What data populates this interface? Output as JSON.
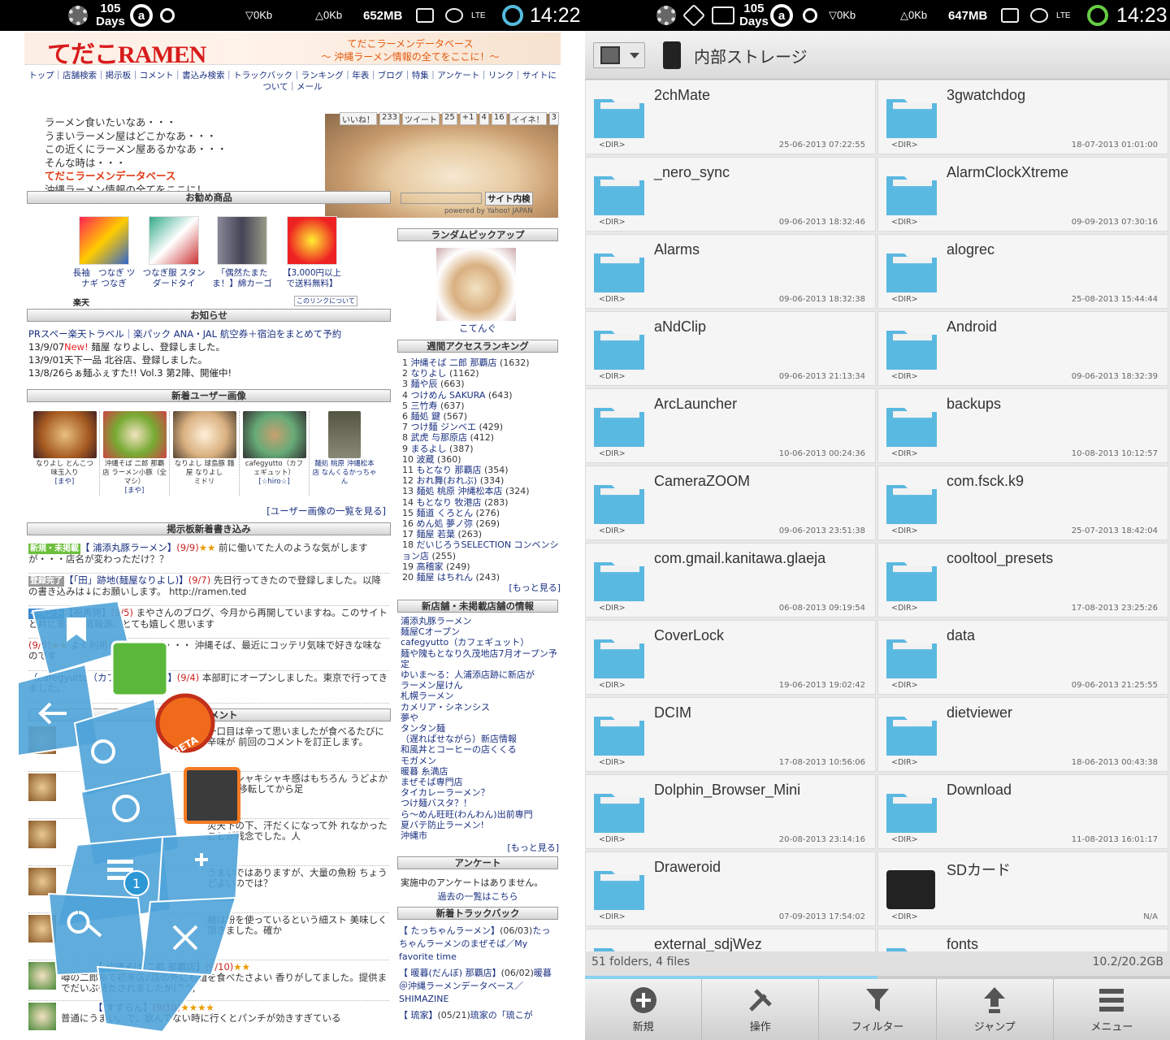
{
  "status_left": {
    "days": "105",
    "days_label": "Days",
    "ring": "a",
    "down": "▽0Kb",
    "up": "△0Kb",
    "mem": "652MB",
    "lte": "LTE",
    "time": "14:22"
  },
  "status_right": {
    "days": "105",
    "days_label": "Days",
    "ring": "a",
    "down": "▽0Kb",
    "up": "△0Kb",
    "mem": "647MB",
    "lte": "LTE",
    "time": "14:23"
  },
  "web": {
    "logo": "てだこRAMEN",
    "banner_line1": "てだこラーメンデータベース",
    "banner_line2": "～ 沖縄ラーメン情報の全てをここに！～",
    "nav": "トップ｜店舗検索｜掲示板｜コメント｜書込み検索｜トラックバック｜ランキング｜年表｜ブログ｜特集｜アンケート｜リンク｜サイトについて｜メール",
    "social": [
      "いいね！",
      "233",
      "ツイート",
      "25",
      "+1",
      "4",
      "16",
      "イイネ！",
      "3"
    ],
    "hero_lines": [
      "ラーメン食いたいなあ・・・",
      "うまいラーメン屋はどこかなあ・・・",
      "この近くにラーメン屋あるかなあ・・・",
      "そんな時は・・・"
    ],
    "hero_title": "てだこラーメンデータベース",
    "hero_sub": "沖縄ラーメン情報の全てをここに！",
    "sec_recommend": "お勧め商品",
    "products": [
      {
        "text": "長袖　つなぎ ツナギ つなぎ"
      },
      {
        "text": "つなぎ服 スタンダードタイ"
      },
      {
        "text": "「偶然たまたま！】綿カーゴ"
      },
      {
        "text": "【3,000円以上で送料無料】"
      }
    ],
    "rakuten": "楽天",
    "affiliate": "このリンクについて",
    "sec_news": "お知らせ",
    "pr": "PRスペー楽天トラベル｜楽パック ANA・JAL 航空券＋宿泊をまとめて予約",
    "news": [
      {
        "date": "13/9/07",
        "new": "New!",
        "text": "麺屋 なりよし、登録しました。"
      },
      {
        "date": "13/9/01",
        "new": "",
        "text": "天下一品 北谷店、登録しました。"
      },
      {
        "date": "13/8/26",
        "new": "",
        "text": "らぁ麺ふぇすた!! Vol.3 第2陣、開催中!"
      }
    ],
    "sec_user_images": "新着ユーザー画像",
    "thumbs": [
      {
        "cap": "なりよし とんこつ味玉入り",
        "user": "[まや]"
      },
      {
        "cap": "沖縄そば 二郎 那覇店 ラーメン小豚（全マシ）",
        "user": "[まや]"
      },
      {
        "cap": "なりよし 球島豚 麺屋 なりよし",
        "user": "ミドリ"
      },
      {
        "cap": "cafegyutto（カフェギュット）",
        "user": "[☆hiro☆]"
      },
      {
        "cap": "麺処 桃原 沖縄松本店 なんくるかっちゃん",
        "user": ""
      }
    ],
    "user_images_more": "[ユーザー画像の一覧を見る]",
    "sec_board": "掲示板新着書き込み",
    "posts": [
      {
        "tag": "新規・未掲載",
        "tagc": "#6cbf3c",
        "title": "【 浦添丸豚ラーメン】",
        "date": "(9/9)",
        "stars": "★★",
        "text": "前に働いてた人のような気がしますが・・・店名が変わっただけ？？"
      },
      {
        "tag": "登録完了",
        "tagc": "#999",
        "title": "【「田」跡地(麺屋なりよし)】",
        "date": "(9/7)",
        "stars": "",
        "text": "先日行ってきたので登録しました。以降の書き込みは↓にお願いします。 http://ramen.ted"
      },
      {
        "tag": "イベント",
        "tagc": "#3a86d0",
        "title": "【祝再開】",
        "date": "(9/5)",
        "stars": "",
        "text": "まやさんのブログ、今月から再開していますね。このサイトと共に重要な情報源、とても嬉しく思います"
      },
      {
        "tag": "",
        "tagc": "",
        "title": "",
        "date": "(9/5)",
        "stars": "★★",
        "text": "よく利用していますが・・・ 沖縄そば、最近にコッテリ気味で好きな味なのです"
      },
      {
        "tag": "",
        "tagc": "",
        "title": "（cafegyutto（カフェギュット）】",
        "date": "(9/4)",
        "stars": "",
        "text": "本部町にオープンしました。東京で行ってきました。"
      }
    ],
    "sec_comment": "新着コメント",
    "comments": [
      "一口目は辛って思いましたが食べるたびに辛味が 前回のコメントを訂正します。",
      "野菜のシャキシャキ感はもちろん うどよかった！ 移転してから足",
      "災天下の下、汗だくになって外 れなかったことが残念でした。人",
      "うまいではありますが、大量の魚粉 ちょうどよいのでは？",
      "麺は粉を使っているという細スト 美味しく頂きました。確か"
    ],
    "posts2": [
      {
        "title": "【 沖縄そば 二郎 那覇店】",
        "date": "(9/10)",
        "stars": "★★",
        "text": "噂の二郎系で初来店♪店の外にも麺を食べたさよい 香りがしてました。提供までだいぶ待たされましたが(^^;"
      },
      {
        "title": "【 すずらん】",
        "date": "(9/10)",
        "stars": "★★★★",
        "text": "普通にうまい。で、飲んでない時に行くとパンチが効きすぎている"
      }
    ],
    "search_button": "サイト内検",
    "powered": "powered by Yahoo! JAPAN",
    "sec_random": "ランダムピックアップ",
    "random_caption": "こてんぐ",
    "sec_ranking": "週間アクセスランキング",
    "ranking": [
      [
        "1",
        "沖縄そば 二郎 那覇店",
        "(1632)"
      ],
      [
        "2",
        "なりよし",
        "(1162)"
      ],
      [
        "3",
        "麺や辰",
        "(663)"
      ],
      [
        "4",
        "つけめん SAKURA",
        "(643)"
      ],
      [
        "5",
        "三竹寿",
        "(637)"
      ],
      [
        "6",
        "麺処 鍵",
        "(567)"
      ],
      [
        "7",
        "つけ麺 ジンベエ",
        "(429)"
      ],
      [
        "8",
        "武虎 与那原店",
        "(412)"
      ],
      [
        "9",
        "まるよし",
        "(387)"
      ],
      [
        "10",
        "波蔵",
        "(360)"
      ],
      [
        "11",
        "もとなり 那覇店",
        "(354)"
      ],
      [
        "12",
        "おれ舞(おれぶ)",
        "(334)"
      ],
      [
        "13",
        "麺処 桃原 沖縄松本店",
        "(324)"
      ],
      [
        "14",
        "もとなり 牧港店",
        "(283)"
      ],
      [
        "15",
        "麺道 くろとん",
        "(276)"
      ],
      [
        "16",
        "めん処 夢ノ弥",
        "(269)"
      ],
      [
        "17",
        "麺屋 若葉",
        "(263)"
      ],
      [
        "18",
        "だいじろうSELECTION コンベンション店",
        "(255)"
      ],
      [
        "19",
        "高稽家",
        "(249)"
      ],
      [
        "20",
        "麺屋 はちれん",
        "(243)"
      ]
    ],
    "ranking_more": "[もっと見る]",
    "sec_shops": "新店舗・未掲載店舗の情報",
    "shops": [
      "浦添丸豚ラーメン",
      "麺屋Cオープン",
      "cafegyutto（カフェギュット）",
      "麺や隗もとなり久茂地店7月オープン予定",
      "ゆいま～る：人浦添店跡に新店が",
      "ラーメン屋けん",
      "札幌ラーメン",
      "カメリア・シネンシス",
      "夢や",
      "タンタン麺",
      "（遅れぱせながら）新店情報",
      "和風丼とコーヒーの店くくる",
      "モガメン",
      "暖暮 糸満店",
      "まぜそば専門店",
      "タイカレーラーメン？",
      "つけ麺バスタ？！",
      "ら～めん旺旺(わんわん)出前専門",
      "夏バテ防止ラーメン!",
      "沖縄市"
    ],
    "shops_more": "[もっと見る]",
    "sec_survey": "アンケート",
    "survey_text": "実施中のアンケートはありません。",
    "survey_link": "過去の一覧はこちら",
    "sec_trackback": "新着トラックバック",
    "trackbacks": [
      {
        "t": "【 たっちゃんラーメン】",
        "d": "(06/03)",
        "x": "たっちゃんラーメンのまぜそば／My favorite time"
      },
      {
        "t": "【 暖暮(だんぼ) 那覇店】",
        "d": "(06/02)",
        "x": "暖暮＠沖縄ラーメンデータベース／SHIMAZINE"
      },
      {
        "t": "【 琉家】",
        "d": "(05/21)",
        "x": "琉家の「琉こが"
      }
    ]
  },
  "pie_menu": {
    "badge": "1",
    "beta": "BETA"
  },
  "fm": {
    "location": "内部ストレージ",
    "items": [
      {
        "name": "2chMate",
        "dir": "<DIR>",
        "date": "25-06-2013 07:22:55"
      },
      {
        "name": "3gwatchdog",
        "dir": "<DIR>",
        "date": "18-07-2013 01:01:00"
      },
      {
        "name": "_nero_sync",
        "dir": "<DIR>",
        "date": "09-06-2013 18:32:46"
      },
      {
        "name": "AlarmClockXtreme",
        "dir": "<DIR>",
        "date": "09-09-2013 07:30:16"
      },
      {
        "name": "Alarms",
        "dir": "<DIR>",
        "date": "09-06-2013 18:32:38"
      },
      {
        "name": "alogrec",
        "dir": "<DIR>",
        "date": "25-08-2013 15:44:44"
      },
      {
        "name": "aNdClip",
        "dir": "<DIR>",
        "date": "09-06-2013 21:13:34"
      },
      {
        "name": "Android",
        "dir": "<DIR>",
        "date": "09-06-2013 18:32:39"
      },
      {
        "name": "ArcLauncher",
        "dir": "<DIR>",
        "date": "10-06-2013 00:24:36"
      },
      {
        "name": "backups",
        "dir": "<DIR>",
        "date": "10-08-2013 10:12:57"
      },
      {
        "name": "CameraZOOM",
        "dir": "<DIR>",
        "date": "09-06-2013 23:51:38"
      },
      {
        "name": "com.fsck.k9",
        "dir": "<DIR>",
        "date": "25-07-2013 18:42:04"
      },
      {
        "name": "com.gmail.kanitawa.glaeja",
        "dir": "<DIR>",
        "date": "06-08-2013 09:19:54"
      },
      {
        "name": "cooltool_presets",
        "dir": "<DIR>",
        "date": "17-08-2013 23:25:26"
      },
      {
        "name": "CoverLock",
        "dir": "<DIR>",
        "date": "19-06-2013 19:02:42"
      },
      {
        "name": "data",
        "dir": "<DIR>",
        "date": "09-06-2013 21:25:55"
      },
      {
        "name": "DCIM",
        "dir": "<DIR>",
        "date": "17-08-2013 10:56:06"
      },
      {
        "name": "dietviewer",
        "dir": "<DIR>",
        "date": "18-06-2013 00:43:38"
      },
      {
        "name": "Dolphin_Browser_Mini",
        "dir": "<DIR>",
        "date": "20-08-2013 23:14:16"
      },
      {
        "name": "Download",
        "dir": "<DIR>",
        "date": "11-08-2013 16:01:17"
      },
      {
        "name": "Draweroid",
        "dir": "<DIR>",
        "date": "07-09-2013 17:54:02"
      },
      {
        "name": "SDカード",
        "dir": "<DIR>",
        "date": "N/A",
        "sd": true
      },
      {
        "name": "external_sdjWez",
        "dir": "",
        "date": ""
      },
      {
        "name": "fonts",
        "dir": "",
        "date": ""
      }
    ],
    "summary": "51 folders, 4 files",
    "storage": "10.2/20.2GB",
    "scroll_fraction": 0.5,
    "bottom": [
      "新規",
      "操作",
      "フィルター",
      "ジャンプ",
      "メニュー"
    ],
    "folder_color": "#5bb8e0"
  }
}
